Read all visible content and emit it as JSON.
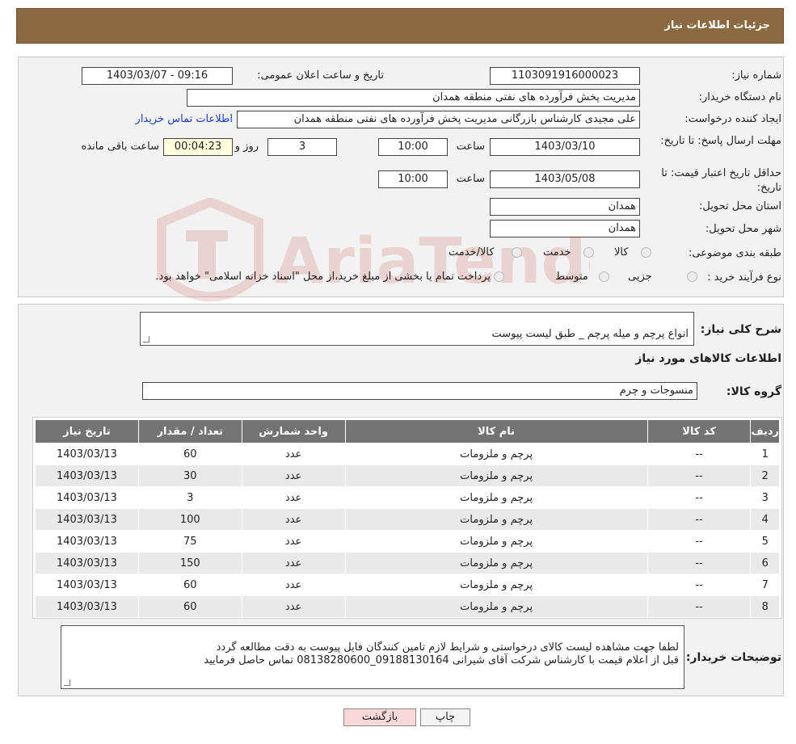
{
  "header": {
    "title": "جزئیات اطلاعات نیاز"
  },
  "form": {
    "need_number_label": "شماره نیاز:",
    "need_number": "1103091916000023",
    "announce_label": "تاریخ و ساعت اعلان عمومی:",
    "announce_value": "1403/03/07 - 09:16",
    "buyer_label": "نام دستگاه خریدار:",
    "buyer_value": "مدیریت پخش فرآورده های نفتی منطقه همدان",
    "creator_label": "ایجاد کننده درخواست:",
    "creator_value": "علی مجیدی کارشناس بازرگانی مدیریت پخش فرآورده های نفتی منطقه همدان",
    "contact_link": "اطلاعات تماس خریدار",
    "deadline_label": "مهلت ارسال پاسخ: تا تاریخ:",
    "deadline_date": "1403/03/10",
    "time_label": "ساعت",
    "deadline_time": "10:00",
    "days_value": "3",
    "days_label": "روز و",
    "remaining_value": "00:04:23",
    "remaining_label": "ساعت باقی مانده",
    "validity_label": "حداقل تاریخ اعتبار قیمت: تا تاریخ:",
    "validity_date": "1403/05/08",
    "validity_time": "10:00",
    "province_label": "استان محل تحویل:",
    "province_value": "همدان",
    "city_label": "شهر محل تحویل:",
    "city_value": "همدان",
    "category_label": "طبقه بندی موضوعی:",
    "category_options": [
      "کالا",
      "خدمت",
      "کالا/خدمت"
    ],
    "process_label": "نوع فرآیند خرید :",
    "process_options": [
      "جزیی",
      "متوسط"
    ],
    "process_note": "پرداخت تمام یا بخشی از مبلغ خرید،از محل \"اسناد خزانه اسلامی\" خواهد بود."
  },
  "details": {
    "summary_label": "شرح کلی نیاز:",
    "summary_value": "انواع پرچم  و میله پرچم _ طبق لیست پیوست",
    "items_heading": "اطلاعات کالاهای مورد نیاز",
    "group_label": "گروه کالا:",
    "group_value": "منسوجات و چرم"
  },
  "table": {
    "headers": [
      "ردیف",
      "کد کالا",
      "نام کالا",
      "واحد شمارش",
      "تعداد / مقدار",
      "تاریخ نیاز"
    ],
    "rows": [
      [
        "1",
        "--",
        "پرچم و ملزومات",
        "عدد",
        "60",
        "1403/03/13"
      ],
      [
        "2",
        "--",
        "پرچم و ملزومات",
        "عدد",
        "30",
        "1403/03/13"
      ],
      [
        "3",
        "--",
        "پرچم و ملزومات",
        "عدد",
        "3",
        "1403/03/13"
      ],
      [
        "4",
        "--",
        "پرچم و ملزومات",
        "عدد",
        "100",
        "1403/03/13"
      ],
      [
        "5",
        "--",
        "پرچم و ملزومات",
        "عدد",
        "75",
        "1403/03/13"
      ],
      [
        "6",
        "--",
        "پرچم و ملزومات",
        "عدد",
        "150",
        "1403/03/13"
      ],
      [
        "7",
        "--",
        "پرچم و ملزومات",
        "عدد",
        "60",
        "1403/03/13"
      ],
      [
        "8",
        "--",
        "پرچم و ملزومات",
        "عدد",
        "60",
        "1403/03/13"
      ]
    ]
  },
  "buyer_notes": {
    "label": "توضیحات خریدار:",
    "value": "لطفا جهت مشاهده لیست کالای درخواستی و شرایط لازم تامین کنندگان فایل پیوست به دقت مطالعه گردد\nقبل از اعلام قیمت با کارشناس شرکت آقای شیرانی 09188130164_08138280600 تماس حاصل فرمایید"
  },
  "buttons": {
    "print": "چاپ",
    "back": "بازگشت"
  },
  "watermark": {
    "text": "AriaTender.neT"
  },
  "colors": {
    "title_bar": "#8b6a42",
    "table_header": "#737373",
    "link": "#1a3dcc",
    "back_button": "#f8d8d8"
  }
}
